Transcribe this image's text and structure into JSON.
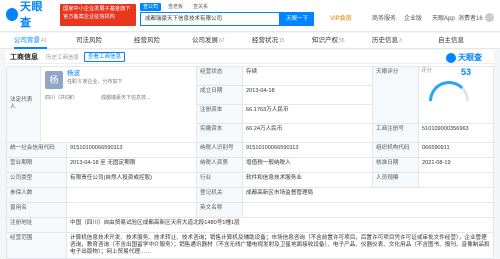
{
  "app": {
    "logo": "天眼查",
    "banner_line1": "国家中小企业发展子基金旗下",
    "banner_line2": "官方备案企业征信机构"
  },
  "search": {
    "tabs": [
      "查公司",
      "查老板",
      "查关系"
    ],
    "value": "成都瑞豪天下信息技术有限公司",
    "button": "天眼一下"
  },
  "nav": {
    "vip": "VIP会员",
    "items": [
      "商务服务",
      "企业版",
      "天眼App",
      "消费者16"
    ]
  },
  "tabs": [
    {
      "label": "公司背景",
      "count": "41"
    },
    {
      "label": "司法风险",
      "count": ""
    },
    {
      "label": "经营风险",
      "count": ""
    },
    {
      "label": "公司发展",
      "count": "67"
    },
    {
      "label": "经营状况",
      "count": "15"
    },
    {
      "label": "知识产权",
      "count": "55"
    },
    {
      "label": "历史信息",
      "count": "3"
    },
    {
      "label": "自主信息",
      "count": ""
    }
  ],
  "section": {
    "title": "工商信息",
    "history": "历史工商信息",
    "button": "查看工商信息",
    "brand": "天眼查"
  },
  "legal": {
    "label": "法定代表人",
    "avatar": "杨",
    "name": "杨波",
    "sub": "任职 6 家企业，分布如下",
    "region": "四川（共6家）",
    "company": "成都瑞豪天下信息技..."
  },
  "score": {
    "label": "评分",
    "value": "53"
  },
  "rows": {
    "status_l": "经营状态",
    "status": "存续",
    "estdate_l": "成立日期",
    "estdate": "2013-04-18",
    "cap_l": "注册资本",
    "cap": "66.1763万人民币",
    "paid_l": "实缴资本",
    "paid": "66.24万人民币",
    "taxpayer_l": "天眼评分",
    "code_l": "统一社会信用代码",
    "code": "91510100066590113",
    "taxid_l": "纳税人识别号",
    "taxid": "91510100066590113",
    "regno_l": "工商注册号",
    "regno": "510109000356963",
    "orgcode_l": "组织机构代码",
    "orgcode": "066590911",
    "term_l": "营业期限",
    "term": "2013-04-18 至 无固定期限",
    "qual_l": "纳税人资质",
    "qual": "增值税一般纳税人",
    "approve_l": "核准日期",
    "approve": "2021-08-19",
    "type_l": "公司类型",
    "type": "有限责任公司(自然人投资或控股)",
    "industry_l": "行业",
    "industry": "软件和信息技术服务业",
    "staff_l": "人员规模",
    "staff": "",
    "insured_l": "参保人数",
    "insured": "",
    "authority_l": "登记机关",
    "authority": "成都高新区市场监督管理局",
    "regaddr_l": "曾用名",
    "regaddr": "",
    "engname_l": "英文名称",
    "engname": "",
    "address_l": "注册地址",
    "address": "中国（四川）自由贸易试验区成都高新区天府大道北段1480号1幢1层",
    "scope_l": "经营范围",
    "scope": "计算机信息技术开发、技术服务、技术转让、技术咨询；销售计算机及辅助设备；市场信息咨询（不含前置许可项目，后置许可项目凭许可证或审批文件经营），企业管理咨询，教育咨询（不含出国留学中介服务）；销售通讯器材（不含无线广播电视发射及卫星地面接收设备）、电子产品、仪器仪表、文化用品（不含图书、报刊、音像制品和电子出版物）；网上贸易代理……"
  }
}
